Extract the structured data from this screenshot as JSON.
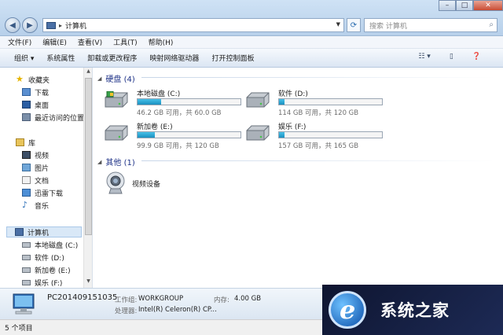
{
  "window": {
    "address_path": "计算机",
    "search_placeholder": "搜索 计算机"
  },
  "menubar": [
    "文件(F)",
    "编辑(E)",
    "查看(V)",
    "工具(T)",
    "帮助(H)"
  ],
  "toolbar": [
    "组织 ▾",
    "系统属性",
    "卸载或更改程序",
    "映射网络驱动器",
    "打开控制面板"
  ],
  "sidebar": {
    "favorites": {
      "label": "收藏夹",
      "items": [
        "下载",
        "桌面",
        "最近访问的位置"
      ]
    },
    "libraries": {
      "label": "库",
      "items": [
        "视频",
        "图片",
        "文档",
        "迅雷下载",
        "音乐"
      ]
    },
    "computer": {
      "label": "计算机",
      "items": [
        "本地磁盘 (C:)",
        "软件 (D:)",
        "新加卷 (E:)",
        "娱乐 (F:)"
      ]
    }
  },
  "main": {
    "hard_disks_header": "硬盘 (4)",
    "other_header": "其他 (1)",
    "drives": [
      {
        "name": "本地磁盘 (C:)",
        "free_text": "46.2 GB 可用，共 60.0 GB",
        "used_fraction": 0.23
      },
      {
        "name": "软件 (D:)",
        "free_text": "114 GB 可用，共 120 GB",
        "used_fraction": 0.05
      },
      {
        "name": "新加卷 (E:)",
        "free_text": "99.9 GB 可用，共 120 GB",
        "used_fraction": 0.17
      },
      {
        "name": "娱乐 (F:)",
        "free_text": "157 GB 可用，共 165 GB",
        "used_fraction": 0.05
      }
    ],
    "other_device": "视频设备"
  },
  "details": {
    "computer_name": "PC201409151035",
    "workgroup_label": "工作组:",
    "workgroup_value": "WORKGROUP",
    "memory_label": "内存:",
    "memory_value": "4.00 GB",
    "cpu_label": "处理器:",
    "cpu_value": "Intel(R) Celeron(R) CP..."
  },
  "status": {
    "items_text": "5 个项目"
  },
  "watermark": {
    "text": "系统之家"
  },
  "colors": {
    "accent": "#1e3287",
    "bar_fill": "#26a0d2"
  }
}
